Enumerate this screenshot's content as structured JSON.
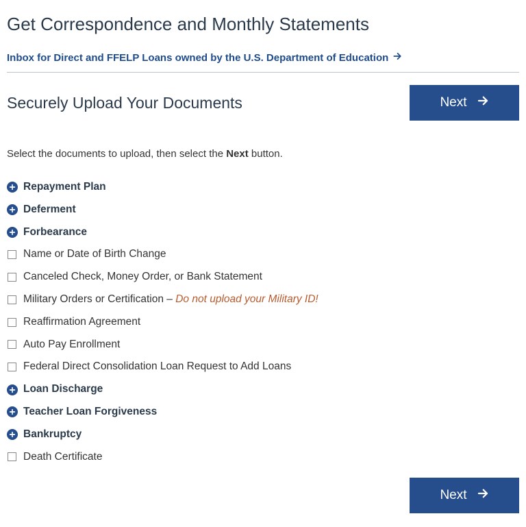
{
  "header": {
    "main_title": "Get Correspondence and Monthly Statements",
    "inbox_link_text": "Inbox for Direct and FFELP Loans owned by the U.S. Department of Education",
    "sub_title": "Securely Upload Your Documents"
  },
  "buttons": {
    "next_label": "Next"
  },
  "instruction": {
    "prefix": "Select the documents to upload, then select the ",
    "emphasis": "Next",
    "suffix": " button."
  },
  "documents": [
    {
      "type": "category",
      "label": "Repayment Plan"
    },
    {
      "type": "category",
      "label": "Deferment"
    },
    {
      "type": "category",
      "label": "Forbearance"
    },
    {
      "type": "checkbox",
      "label": "Name or Date of Birth Change"
    },
    {
      "type": "checkbox",
      "label": "Canceled Check, Money Order, or Bank Statement"
    },
    {
      "type": "checkbox",
      "label": "Military Orders or Certification",
      "note_sep": " – ",
      "note": "Do not upload your Military ID!"
    },
    {
      "type": "checkbox",
      "label": "Reaffirmation Agreement"
    },
    {
      "type": "checkbox",
      "label": "Auto Pay Enrollment"
    },
    {
      "type": "checkbox",
      "label": "Federal Direct Consolidation Loan Request to Add Loans"
    },
    {
      "type": "category",
      "label": "Loan Discharge"
    },
    {
      "type": "category",
      "label": "Teacher Loan Forgiveness"
    },
    {
      "type": "category",
      "label": "Bankruptcy"
    },
    {
      "type": "checkbox",
      "label": "Death Certificate"
    }
  ]
}
